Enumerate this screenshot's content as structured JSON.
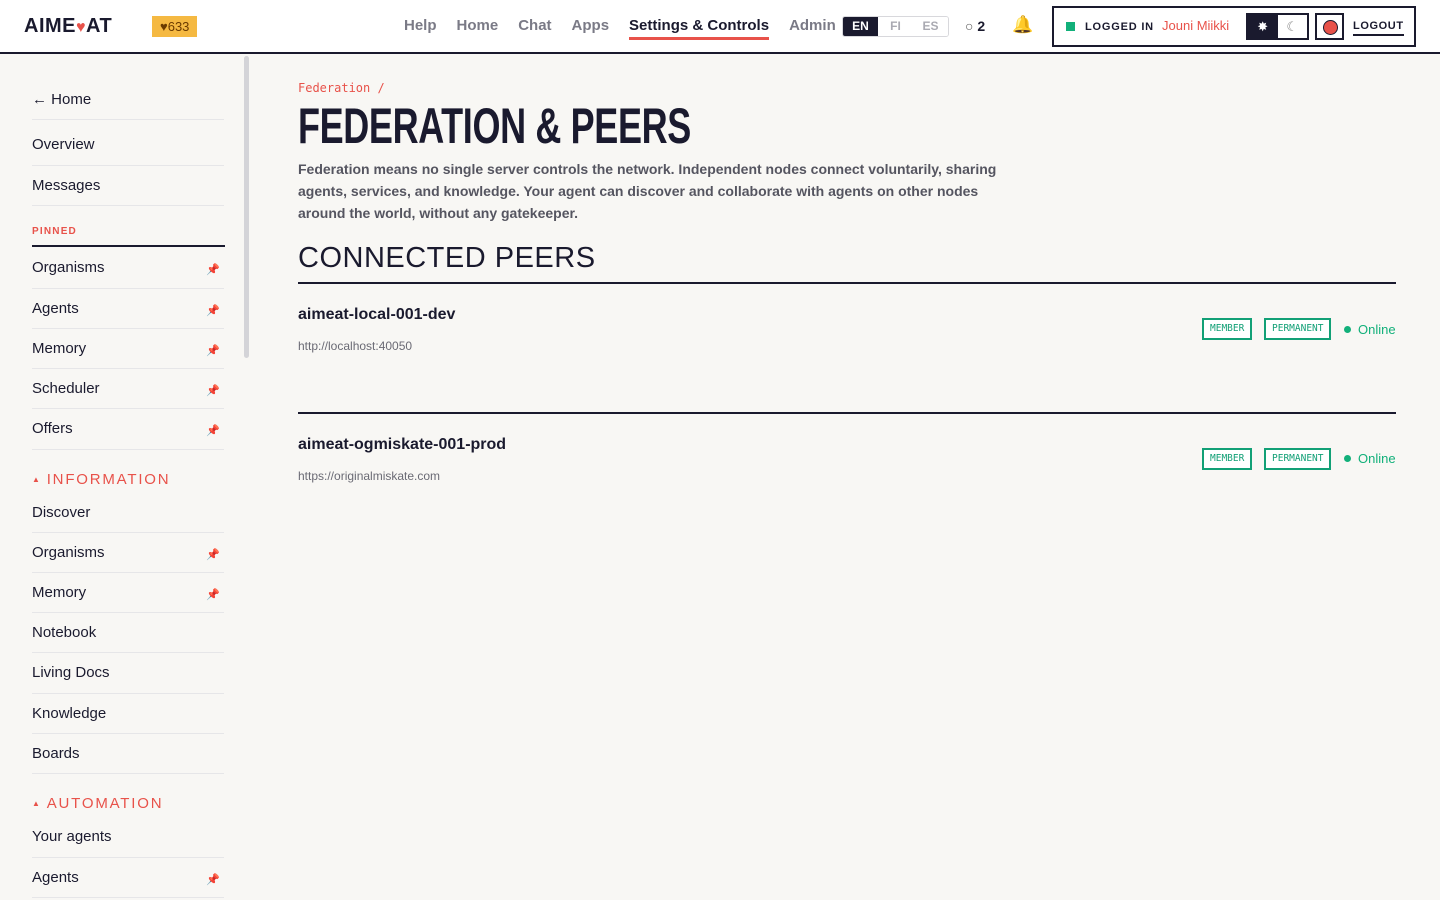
{
  "header": {
    "logo_left": "AIME",
    "logo_heart": "♥",
    "logo_right": "AT",
    "hearts_badge": "♥633",
    "nav": [
      "Help",
      "Home",
      "Chat",
      "Apps",
      "Settings & Controls",
      "Admin"
    ],
    "active_nav": "Settings & Controls",
    "languages": [
      "EN",
      "FI",
      "ES"
    ],
    "active_language": "EN",
    "count_ring": "○",
    "count_value": "2",
    "bell_icon": "🔔",
    "logged_in_label": "LOGGED IN",
    "username": "Jouni Miikki",
    "theme_light_icon": "✸",
    "theme_dark_icon": "☾",
    "logout_label": "LOGOUT"
  },
  "sidebar": {
    "home": "← Home",
    "overview": "Overview",
    "messages": "Messages",
    "pinned_label": "PINNED",
    "pinned": [
      "Organisms",
      "Agents",
      "Memory",
      "Scheduler",
      "Offers"
    ],
    "information_label": "INFORMATION",
    "information": [
      "Discover",
      "Organisms",
      "Memory",
      "Notebook",
      "Living Docs",
      "Knowledge",
      "Boards"
    ],
    "automation_label": "AUTOMATION",
    "automation": [
      "Your agents",
      "Agents"
    ],
    "pin_icon": "📌",
    "collapse_icon": "▲"
  },
  "main": {
    "breadcrumb": "Federation /",
    "title": "FEDERATION & PEERS",
    "description": "Federation means no single server controls the network. Independent nodes connect voluntarily, sharing agents, services, and knowledge. Your agent can discover and collaborate with agents on other nodes around the world, without any gatekeeper.",
    "section_title": "CONNECTED PEERS",
    "peers": [
      {
        "name": "aimeat-local-001-dev",
        "url": "http://localhost:40050",
        "tags": [
          "MEMBER",
          "PERMANENT"
        ],
        "status": "Online"
      },
      {
        "name": "aimeat-ogmiskate-001-prod",
        "url": "https://originalmiskate.com",
        "tags": [
          "MEMBER",
          "PERMANENT"
        ],
        "status": "Online"
      }
    ]
  },
  "colors": {
    "accent": "#e8524a",
    "ink": "#1a1a2e",
    "online": "#12b07a",
    "badge": "#f5b942"
  }
}
